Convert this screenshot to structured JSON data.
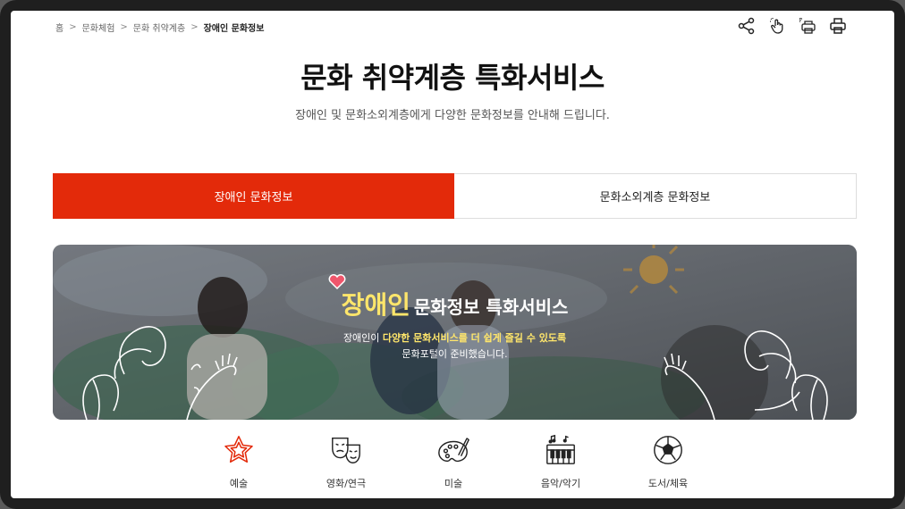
{
  "breadcrumb": {
    "home": "홈",
    "level1": "문화체험",
    "level2": "문화 취약계층",
    "current": "장애인 문화정보",
    "sep": ">"
  },
  "tools": {
    "share": "share-icon",
    "touch": "touch-icon",
    "print_preview": "print-preview-icon",
    "print": "print-icon"
  },
  "header": {
    "title": "문화 취약계층 특화서비스",
    "subtitle": "장애인 및 문화소외계층에게 다양한 문화정보를 안내해 드립니다."
  },
  "tabs": [
    {
      "label": "장애인 문화정보",
      "active": true
    },
    {
      "label": "문화소외계층 문화정보",
      "active": false
    }
  ],
  "banner": {
    "highlight": "장애인",
    "headline_rest": "문화정보 특화서비스",
    "line1_prefix": "장애인이 ",
    "line1_highlight": "다양한 문화서비스를 더 쉽게 즐길 수 있도록",
    "line2": "문화포털이 준비했습니다."
  },
  "categories": [
    {
      "label": "예술",
      "icon": "star-icon"
    },
    {
      "label": "영화/연극",
      "icon": "theater-masks-icon"
    },
    {
      "label": "미술",
      "icon": "palette-icon"
    },
    {
      "label": "음악/악기",
      "icon": "piano-icon"
    },
    {
      "label": "도서/체육",
      "icon": "soccer-ball-icon"
    }
  ],
  "colors": {
    "accent": "#e32a0a",
    "highlight": "#ffe66b"
  }
}
